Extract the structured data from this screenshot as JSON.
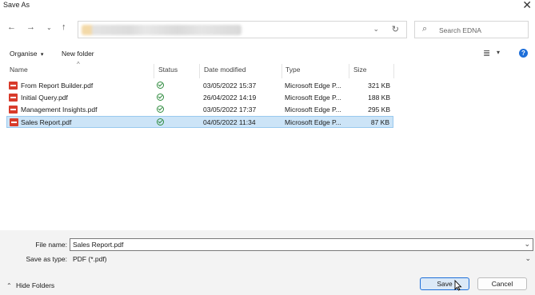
{
  "window": {
    "title": "Save As",
    "close_icon": "close-icon"
  },
  "navigation": {
    "back_icon": "back-arrow-icon",
    "forward_icon": "forward-arrow-icon",
    "recent_icon": "chevron-down-icon",
    "up_icon": "up-arrow-icon",
    "address_dropdown_icon": "chevron-down-icon",
    "refresh_icon": "refresh-icon",
    "search_placeholder": "Search EDNA",
    "search_icon": "search-icon"
  },
  "toolbar": {
    "organise": "Organise",
    "organise_icon": "chevron-down-icon",
    "new_folder": "New folder",
    "view_icon": "view-menu-icon",
    "help_icon": "help-icon",
    "help_glyph": "?"
  },
  "columns": {
    "name": "Name",
    "status": "Status",
    "date_modified": "Date modified",
    "type": "Type",
    "size": "Size"
  },
  "files": [
    {
      "name": "From Report Builder.pdf",
      "status": "synced",
      "date": "03/05/2022 15:37",
      "type": "Microsoft Edge P...",
      "size": "321 KB",
      "selected": false
    },
    {
      "name": "Initial Query.pdf",
      "status": "synced",
      "date": "26/04/2022 14:19",
      "type": "Microsoft Edge P...",
      "size": "188 KB",
      "selected": false
    },
    {
      "name": "Management Insights.pdf",
      "status": "synced",
      "date": "03/05/2022 17:37",
      "type": "Microsoft Edge P...",
      "size": "295 KB",
      "selected": false
    },
    {
      "name": "Sales Report.pdf",
      "status": "synced",
      "date": "04/05/2022 11:34",
      "type": "Microsoft Edge P...",
      "size": "87 KB",
      "selected": true
    }
  ],
  "form": {
    "file_name_label": "File name:",
    "file_name_value": "Sales Report.pdf",
    "save_type_label": "Save as type:",
    "save_type_value": "PDF (*.pdf)"
  },
  "footer": {
    "hide_folders": "Hide Folders",
    "hide_folders_icon": "chevron-up-icon",
    "save": "Save",
    "cancel": "Cancel"
  },
  "colors": {
    "selected_row_bg": "#cce4f7",
    "selected_row_border": "#99c9ef",
    "primary_button_border": "#1e6fd9",
    "pdf_icon": "#d83b2b",
    "status_ok": "#2e8b3e"
  }
}
